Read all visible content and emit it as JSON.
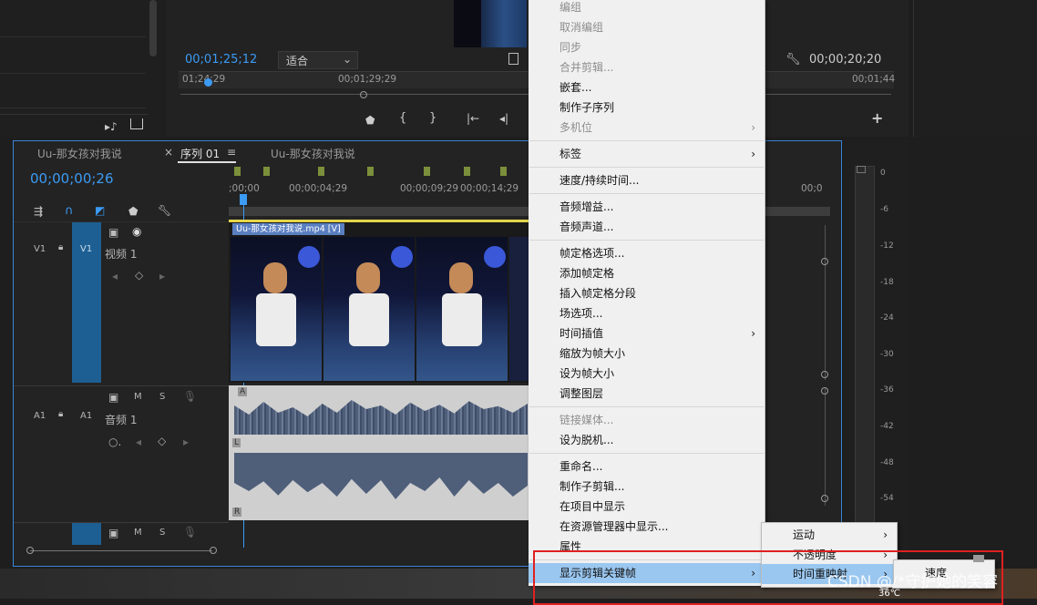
{
  "monitor": {
    "timecode": "00;01;25;12",
    "fit": "适合",
    "right_timecode": "00;00;20;20",
    "ruler": [
      "01;24;29",
      "00;01;29;29",
      "00;01;44"
    ]
  },
  "timeline": {
    "tabs": [
      "Uu-那女孩对我说",
      "序列 01",
      "Uu-那女孩对我说"
    ],
    "tab_close": "×",
    "tab_menu": "≡",
    "timecode": "00;00;00;26",
    "ruler": [
      ";00;00",
      "00;00;04;29",
      "00;00;09;29",
      "00;00;14;29",
      "00;0"
    ],
    "tracks": {
      "v1_src": "V1",
      "v1": "V1",
      "v1_name": "视频 1",
      "a1_src": "A1",
      "a1": "A1",
      "a1_name": "音频 1",
      "m": "M",
      "s": "S"
    },
    "clip_label": "Uu-那女孩对我说.mp4 [V]",
    "audio_l": "L",
    "audio_r": "R",
    "audio_marker": "A"
  },
  "meter": [
    "0",
    "-6",
    "-12",
    "-18",
    "-24",
    "-30",
    "-36",
    "-42",
    "-48",
    "-54"
  ],
  "context_menu": {
    "items": [
      {
        "label": "编组",
        "disabled": true
      },
      {
        "label": "取消编组",
        "disabled": true
      },
      {
        "label": "同步",
        "disabled": true
      },
      {
        "label": "合并剪辑...",
        "disabled": true
      },
      {
        "label": "嵌套...",
        "disabled": false
      },
      {
        "label": "制作子序列",
        "disabled": false
      },
      {
        "label": "多机位",
        "disabled": true
      },
      {
        "label": "标签",
        "disabled": false
      },
      {
        "label": "速度/持续时间...",
        "disabled": false
      },
      {
        "label": "音频增益...",
        "disabled": false
      },
      {
        "label": "音频声道...",
        "disabled": false
      },
      {
        "label": "帧定格选项...",
        "disabled": false
      },
      {
        "label": "添加帧定格",
        "disabled": false
      },
      {
        "label": "插入帧定格分段",
        "disabled": false
      },
      {
        "label": "场选项...",
        "disabled": false
      },
      {
        "label": "时间插值",
        "disabled": false
      },
      {
        "label": "缩放为帧大小",
        "disabled": false
      },
      {
        "label": "设为帧大小",
        "disabled": false
      },
      {
        "label": "调整图层",
        "disabled": false
      },
      {
        "label": "链接媒体...",
        "disabled": true
      },
      {
        "label": "设为脱机...",
        "disabled": false
      },
      {
        "label": "重命名...",
        "disabled": false
      },
      {
        "label": "制作子剪辑...",
        "disabled": false
      },
      {
        "label": "在项目中显示",
        "disabled": false
      },
      {
        "label": "在资源管理器中显示...",
        "disabled": false
      },
      {
        "label": "属性",
        "disabled": false
      },
      {
        "label": "显示剪辑关键帧",
        "disabled": false
      }
    ],
    "arrow": "›"
  },
  "submenu1": [
    "运动",
    "不透明度",
    "时间重映射"
  ],
  "submenu2": [
    "速度"
  ],
  "temperature": "36℃",
  "watermark": "CSDN @/*守护她的笑容"
}
